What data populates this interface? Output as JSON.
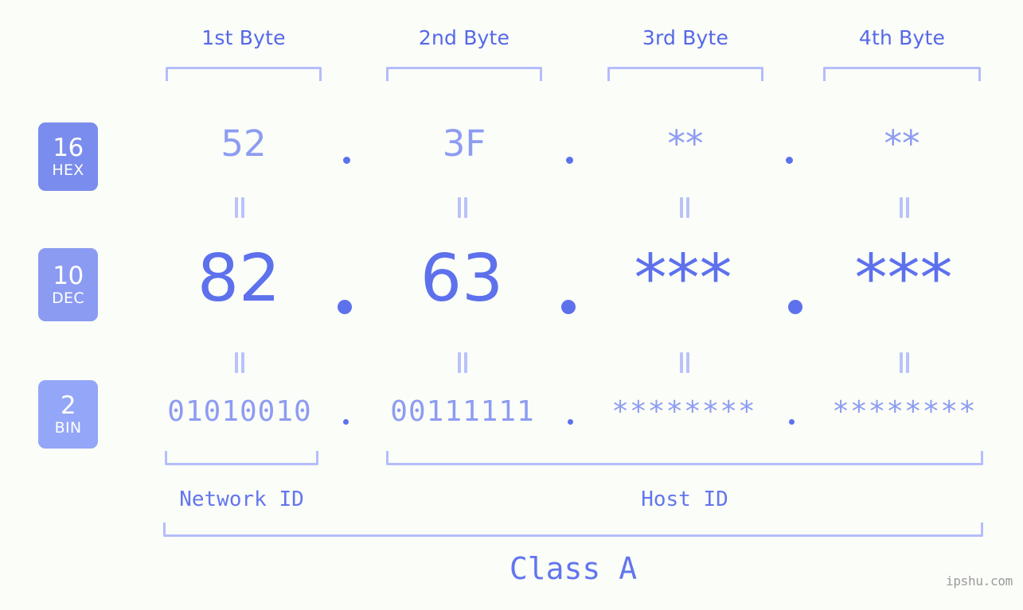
{
  "background_color": "#fbfdf8",
  "accent_color": "#5d71ed",
  "accent_light_color": "#8d9cf2",
  "bracket_color": "#b4bdfb",
  "byte_headers": [
    {
      "label": "1st Byte"
    },
    {
      "label": "2nd Byte"
    },
    {
      "label": "3rd Byte"
    },
    {
      "label": "4th Byte"
    }
  ],
  "rows": [
    {
      "base": "16",
      "system": "HEX",
      "badge_color": "#7a8ced",
      "values": [
        "52",
        "3F",
        "**",
        "**"
      ],
      "separator": "."
    },
    {
      "base": "10",
      "system": "DEC",
      "badge_color": "#8b9bf2",
      "values": [
        "82",
        "63",
        "***",
        "***"
      ],
      "separator": "."
    },
    {
      "base": "2",
      "system": "BIN",
      "badge_color": "#94a6f7",
      "values": [
        "01010010",
        "00111111",
        "********",
        "********"
      ],
      "separator": "."
    }
  ],
  "equal_marks": {
    "symbol": "=",
    "count": 8
  },
  "sections": {
    "network_id": "Network ID",
    "host_id": "Host ID",
    "class": "Class A"
  },
  "watermark": "ipshu.com"
}
